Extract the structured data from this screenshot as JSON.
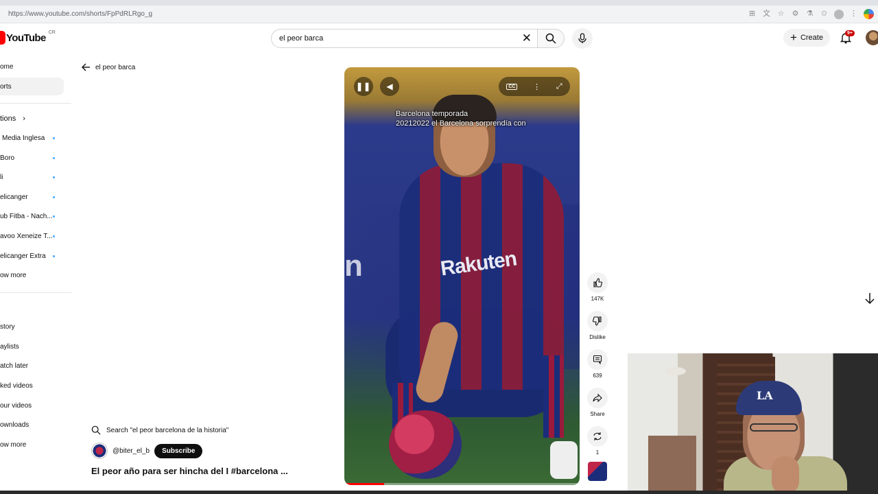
{
  "browser": {
    "url": "https://www.youtube.com/shorts/FpPdRLRgo_g",
    "icons": [
      "translate-icon",
      "star-icon",
      "extension-icon",
      "lab-icon",
      "bookmark-icon",
      "profile-icon",
      "menu-icon",
      "chrome-ext-icon"
    ]
  },
  "header": {
    "logo_text": "YouTube",
    "logo_region": "CR",
    "search_value": "el peor barca",
    "create_label": "Create",
    "notification_count": "9+"
  },
  "sidebar": {
    "top_items": [
      {
        "label": "ome"
      },
      {
        "label": "orts"
      }
    ],
    "subscriptions_title": "tions",
    "subscriptions": [
      {
        "label": "Media Inglesa"
      },
      {
        "label": "Boro"
      },
      {
        "label": "li"
      },
      {
        "label": "elicanger"
      },
      {
        "label": "ub Fitba - Nach..."
      },
      {
        "label": "avoo Xeneize T..."
      },
      {
        "label": "elicanger Extra"
      },
      {
        "label": "ow more"
      }
    ],
    "you_items": [
      {
        "label": "story"
      },
      {
        "label": "aylists"
      },
      {
        "label": "atch later"
      },
      {
        "label": "ked videos"
      },
      {
        "label": "our videos"
      },
      {
        "label": "ownloads"
      },
      {
        "label": "ow more"
      }
    ]
  },
  "back_link": {
    "label": "el peor barca"
  },
  "player": {
    "caption_line1": "Barcelona temporada",
    "caption_line2": "20212022 el Barcelona sorprendía con",
    "cc_label": "CC",
    "sponsor_text": "Rakuten",
    "wall_text": "n",
    "progress_fraction": 0.17
  },
  "actions": {
    "like_count": "147K",
    "dislike_label": "Dislike",
    "comment_count": "639",
    "share_label": "Share",
    "remix_count": "1"
  },
  "short_info": {
    "related_search": "Search \"el peor barcelona de la historia\"",
    "channel_handle": "@biter_el_b",
    "subscribe_label": "Subscribe",
    "title": "El peor año para ser hincha del I #barcelona ..."
  },
  "webcam": {
    "cap_logo": "LA"
  },
  "colors": {
    "brand_red": "#ff0000",
    "subscribe_bg": "#0f0f0f",
    "badge_red": "#cc0000",
    "dot_blue": "#3ea6ff"
  }
}
